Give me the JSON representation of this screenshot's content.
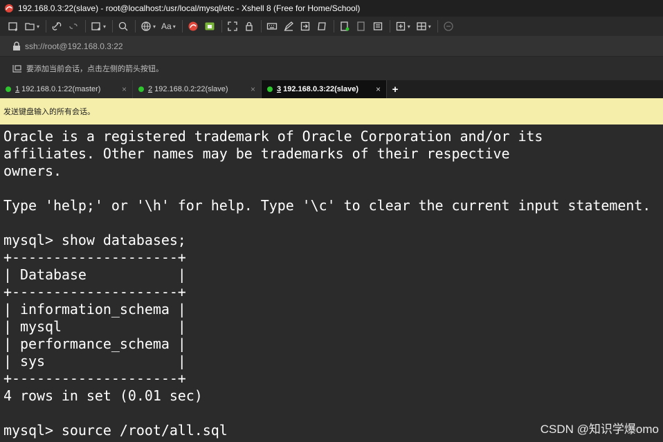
{
  "window": {
    "title": "192.168.0.3:22(slave) - root@localhost:/usr/local/mysql/etc - Xshell 8 (Free for Home/School)",
    "accent_color": "#2ec52e"
  },
  "toolbar": {
    "icons": [
      "new-session-icon",
      "open-folder-icon",
      "connect-icon",
      "disconnect-icon",
      "new-window-icon",
      "search-icon",
      "globe-icon",
      "font-icon",
      "xshell-logo-icon",
      "xftp-icon",
      "fullscreen-icon",
      "lock-icon",
      "keyboard-icon",
      "compose-icon",
      "transfer-icon",
      "script-icon",
      "log-icon",
      "print-icon",
      "layout-icon",
      "add-pane-icon",
      "tile-icon",
      "help-icon"
    ],
    "font_label": "Aa"
  },
  "address": {
    "value": "ssh://root@192.168.0.3:22"
  },
  "hint": {
    "text": "要添加当前会话，点击左侧的箭头按钮。"
  },
  "tabs": [
    {
      "num": "1",
      "label": "192.168.0.1:22(master)",
      "active": false
    },
    {
      "num": "2",
      "label": "192.168.0.2:22(slave)",
      "active": false
    },
    {
      "num": "3",
      "label": "192.168.0.3:22(slave)",
      "active": true
    }
  ],
  "add_tab_label": "+",
  "close_glyph": "×",
  "send_bar": {
    "text": "发送键盘输入的所有会话。"
  },
  "terminal": {
    "lines": [
      "Oracle is a registered trademark of Oracle Corporation and/or its",
      "affiliates. Other names may be trademarks of their respective",
      "owners.",
      "",
      "Type 'help;' or '\\h' for help. Type '\\c' to clear the current input statement.",
      "",
      "mysql> show databases;",
      "+--------------------+",
      "| Database           |",
      "+--------------------+",
      "| information_schema |",
      "| mysql              |",
      "| performance_schema |",
      "| sys                |",
      "+--------------------+",
      "4 rows in set (0.01 sec)",
      "",
      "mysql> source /root/all.sql"
    ]
  },
  "watermark": "CSDN @知识学爆omo"
}
